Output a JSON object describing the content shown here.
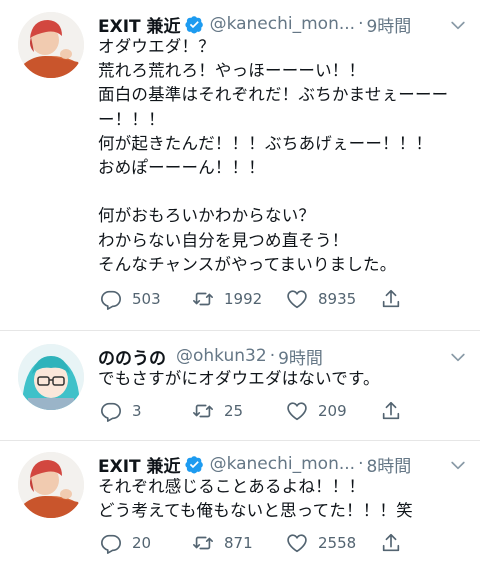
{
  "tweets": [
    {
      "author_name": "EXIT 兼近",
      "handle": "@kanechi_mon...",
      "separator": "·",
      "time": "9時間",
      "verified": true,
      "text": "オダウエダ！？\n荒れろ荒れろ！やっほーーーい！！\n面白の基準はそれぞれだ！ぶちかませぇーーーー！！！\n何が起きたんだ！！！ぶちあげぇーー！！！\nおめぽーーーん！！！\n\n何がおもろいかわからない？\nわからない自分を見つめ直そう！\nそんなチャンスがやってまいりました。",
      "replies": "503",
      "retweets": "1992",
      "likes": "8935"
    },
    {
      "author_name": "ののうの",
      "handle": "@ohkun32",
      "separator": "·",
      "time": "9時間",
      "verified": false,
      "text": "でもさすがにオダウエダはないです。",
      "replies": "3",
      "retweets": "25",
      "likes": "209"
    },
    {
      "author_name": "EXIT 兼近",
      "handle": "@kanechi_mon...",
      "separator": "·",
      "time": "8時間",
      "verified": true,
      "text": "それぞれ感じることあるよね！！！\nどう考えても俺もないと思ってた！！！笑",
      "replies": "20",
      "retweets": "871",
      "likes": "2558"
    }
  ],
  "colors": {
    "verified_badge": "#1d9bf0",
    "secondary_text": "#657786",
    "action_icon": "#536471"
  },
  "icons": {
    "reply": "reply-icon",
    "retweet": "retweet-icon",
    "like": "like-icon",
    "share": "share-icon",
    "more": "more-chevron-icon",
    "verified": "verified-badge-icon"
  }
}
